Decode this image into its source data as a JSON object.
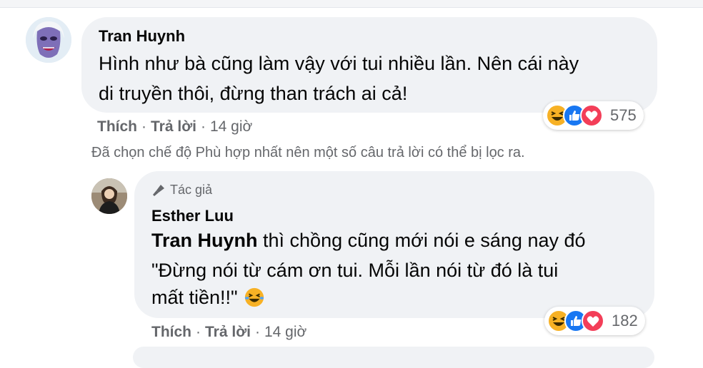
{
  "comment1": {
    "author": "Tran Huynh",
    "text_line1": "Hình như bà cũng làm vậy với tui nhiều lần. Nên cái này",
    "text_line2": "di truyền thôi, đừng than trách ai cả!",
    "actions": {
      "like": "Thích",
      "reply": "Trả lời",
      "time": "14 giờ"
    },
    "reactions": {
      "count": "575",
      "icons": [
        "haha-icon",
        "like-icon",
        "love-icon"
      ]
    }
  },
  "filter_notice": "Đã chọn chế độ Phù hợp nhất nên một số câu trả lời có thể bị lọc ra.",
  "reply1": {
    "badge": "Tác giả",
    "author": "Esther Luu",
    "mention": "Tran Huynh",
    "text_after_mention": " thì chồng cũng mới nói e sáng nay đó",
    "text_line2": "\"Đừng nói từ cám ơn tui. Mỗi lần nói từ đó là tui",
    "text_line3": "mất tiền!!\"",
    "actions": {
      "like": "Thích",
      "reply": "Trả lời",
      "time": "14 giờ"
    },
    "reactions": {
      "count": "182",
      "icons": [
        "haha-icon",
        "like-icon",
        "love-icon"
      ]
    }
  },
  "colors": {
    "bubble": "#f0f2f5",
    "secondary_text": "#65676b",
    "like_blue": "#1877f2",
    "love_red": "#f33e58",
    "haha_yellow": "#f7b125"
  }
}
